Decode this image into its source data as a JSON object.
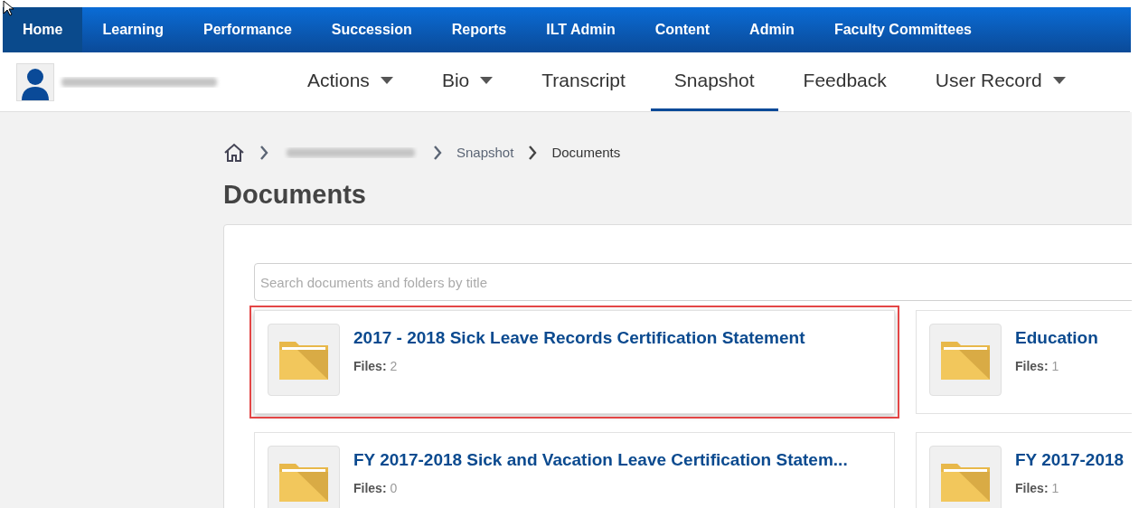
{
  "top_nav": [
    {
      "label": "Home",
      "selected": true
    },
    {
      "label": "Learning",
      "selected": false
    },
    {
      "label": "Performance",
      "selected": false
    },
    {
      "label": "Succession",
      "selected": false
    },
    {
      "label": "Reports",
      "selected": false
    },
    {
      "label": "ILT Admin",
      "selected": false
    },
    {
      "label": "Content",
      "selected": false
    },
    {
      "label": "Admin",
      "selected": false
    },
    {
      "label": "Faculty Committees",
      "selected": false
    }
  ],
  "user_tabs": [
    {
      "label": "Actions",
      "selected": false,
      "has_menu": true
    },
    {
      "label": "Bio",
      "selected": false,
      "has_menu": true
    },
    {
      "label": "Transcript",
      "selected": false,
      "has_menu": false
    },
    {
      "label": "Snapshot",
      "selected": true,
      "has_menu": false
    },
    {
      "label": "Feedback",
      "selected": false,
      "has_menu": false
    },
    {
      "label": "User Record",
      "selected": false,
      "has_menu": true
    }
  ],
  "breadcrumb": [
    {
      "label": "Snapshot",
      "current": false
    },
    {
      "label": "Documents",
      "current": true
    }
  ],
  "page_title": "Documents",
  "search": {
    "placeholder": "Search documents and folders by title"
  },
  "folders": [
    {
      "title": "2017 - 2018 Sick Leave Records Certification Statement",
      "files_label": "Files:",
      "files_count": "2",
      "highlighted": true
    },
    {
      "title": "Education",
      "files_label": "Files:",
      "files_count": "1",
      "highlighted": false
    },
    {
      "title": "FY 2017-2018 Sick and Vacation Leave Certification Statem...",
      "files_label": "Files:",
      "files_count": "0",
      "highlighted": false
    },
    {
      "title": "FY 2017-2018",
      "files_label": "Files:",
      "files_count": "1",
      "highlighted": false
    }
  ]
}
